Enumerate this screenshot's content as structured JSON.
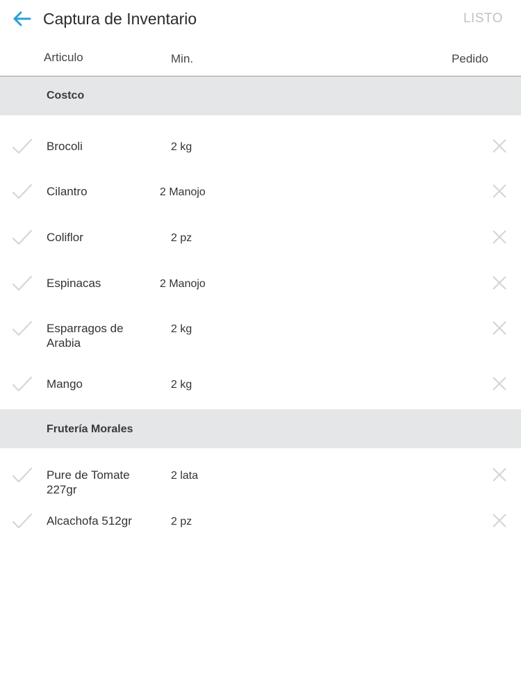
{
  "header": {
    "back_icon": "arrow-left-icon",
    "title": "Captura de Inventario",
    "done_label": "LISTO",
    "accent_color": "#2a9fd8"
  },
  "columns": {
    "item": "Articulo",
    "min": "Min.",
    "order": "Pedido"
  },
  "sections": [
    {
      "name": "Costco",
      "items": [
        {
          "name": "Brocoli",
          "min": "2 kg"
        },
        {
          "name": "Cilantro",
          "min": "2 Manojo"
        },
        {
          "name": "Coliflor",
          "min": "2 pz"
        },
        {
          "name": "Espinacas",
          "min": "2 Manojo"
        },
        {
          "name": "Esparragos de Arabia",
          "min": "2 kg"
        },
        {
          "name": "Mango",
          "min": "2 kg"
        }
      ]
    },
    {
      "name": "Frutería Morales",
      "items": [
        {
          "name": "Pure de Tomate 227gr",
          "min": "2 lata"
        },
        {
          "name": "Alcachofa 512gr",
          "min": "2 pz"
        }
      ]
    }
  ],
  "icons": {
    "check": "check-icon",
    "remove": "close-icon"
  }
}
